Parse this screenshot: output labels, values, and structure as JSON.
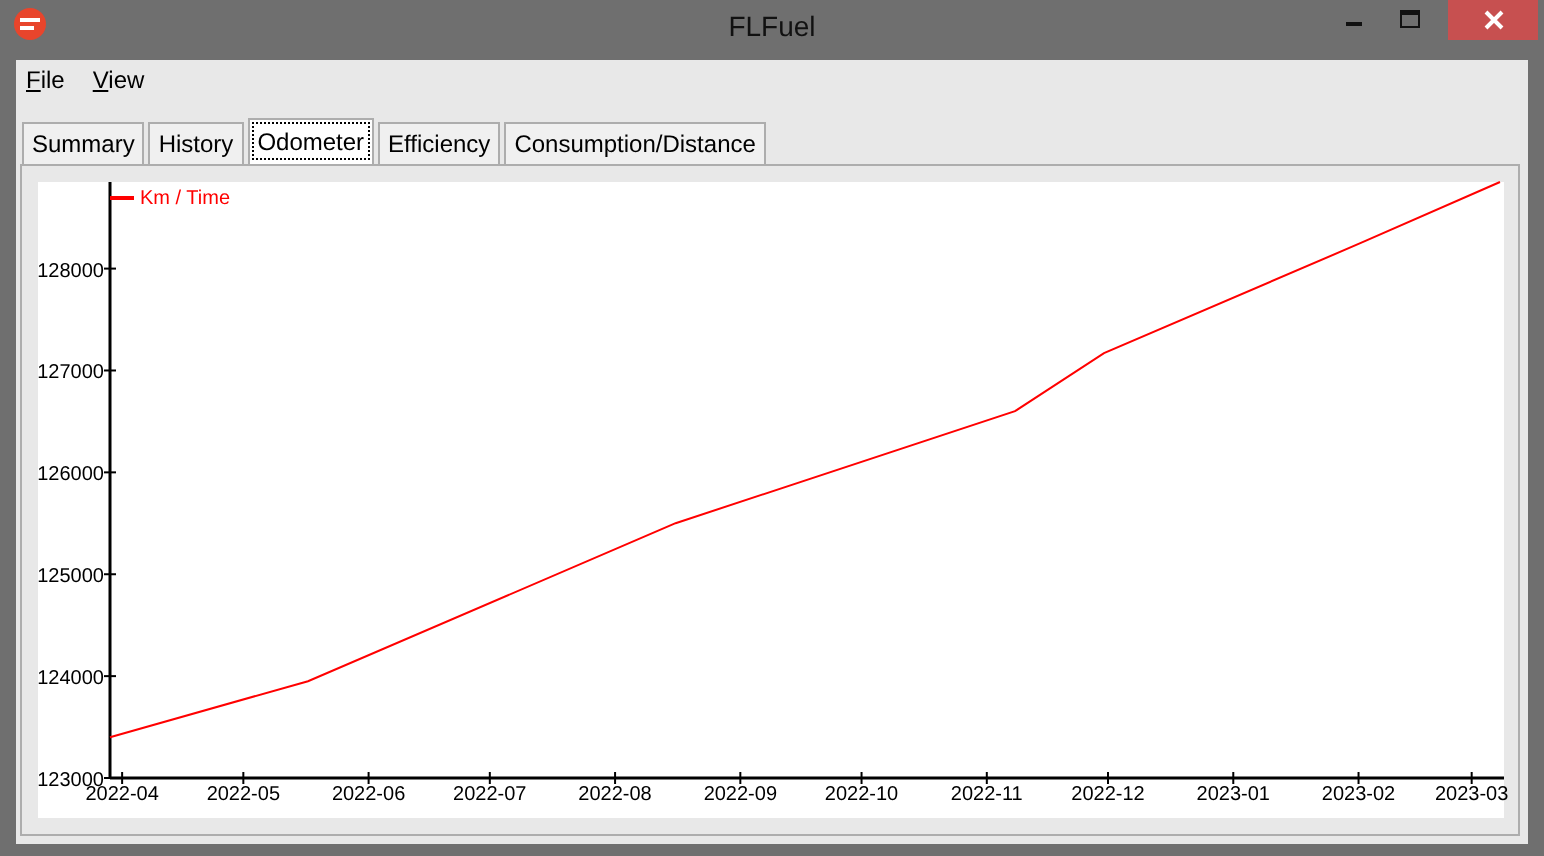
{
  "window": {
    "title": "FLFuel"
  },
  "menu": [
    "File",
    "View"
  ],
  "tabs": [
    {
      "label": "Summary",
      "selected": false
    },
    {
      "label": "History",
      "selected": false
    },
    {
      "label": "Odometer",
      "selected": true
    },
    {
      "label": "Efficiency",
      "selected": false
    },
    {
      "label": "Consumption/Distance",
      "selected": false
    }
  ],
  "chart_data": {
    "type": "line",
    "x": [
      "2022-03-29",
      "2022-05-17",
      "2022-08-16",
      "2022-11-08",
      "2022-11-30",
      "2023-02-02",
      "2023-03-08"
    ],
    "xlim": [
      "2022-03-29",
      "2023-03-09"
    ],
    "ylim": [
      123000,
      128850
    ],
    "xticks": [
      {
        "value": "2022-04-01",
        "label": "2022-04"
      },
      {
        "value": "2022-05-01",
        "label": "2022-05"
      },
      {
        "value": "2022-06-01",
        "label": "2022-06"
      },
      {
        "value": "2022-07-01",
        "label": "2022-07"
      },
      {
        "value": "2022-08-01",
        "label": "2022-08"
      },
      {
        "value": "2022-09-01",
        "label": "2022-09"
      },
      {
        "value": "2022-10-01",
        "label": "2022-10"
      },
      {
        "value": "2022-11-01",
        "label": "2022-11"
      },
      {
        "value": "2022-12-01",
        "label": "2022-12"
      },
      {
        "value": "2023-01-01",
        "label": "2023-01"
      },
      {
        "value": "2023-02-01",
        "label": "2023-02"
      },
      {
        "value": "2023-03-01",
        "label": "2023-03"
      }
    ],
    "yticks": [
      123000,
      124000,
      125000,
      126000,
      127000,
      128000
    ],
    "series": [
      {
        "name": "Km / Time",
        "color": "#ff0000",
        "values": [
          123400,
          123950,
          125500,
          126600,
          127170,
          128260,
          128850
        ]
      }
    ]
  }
}
